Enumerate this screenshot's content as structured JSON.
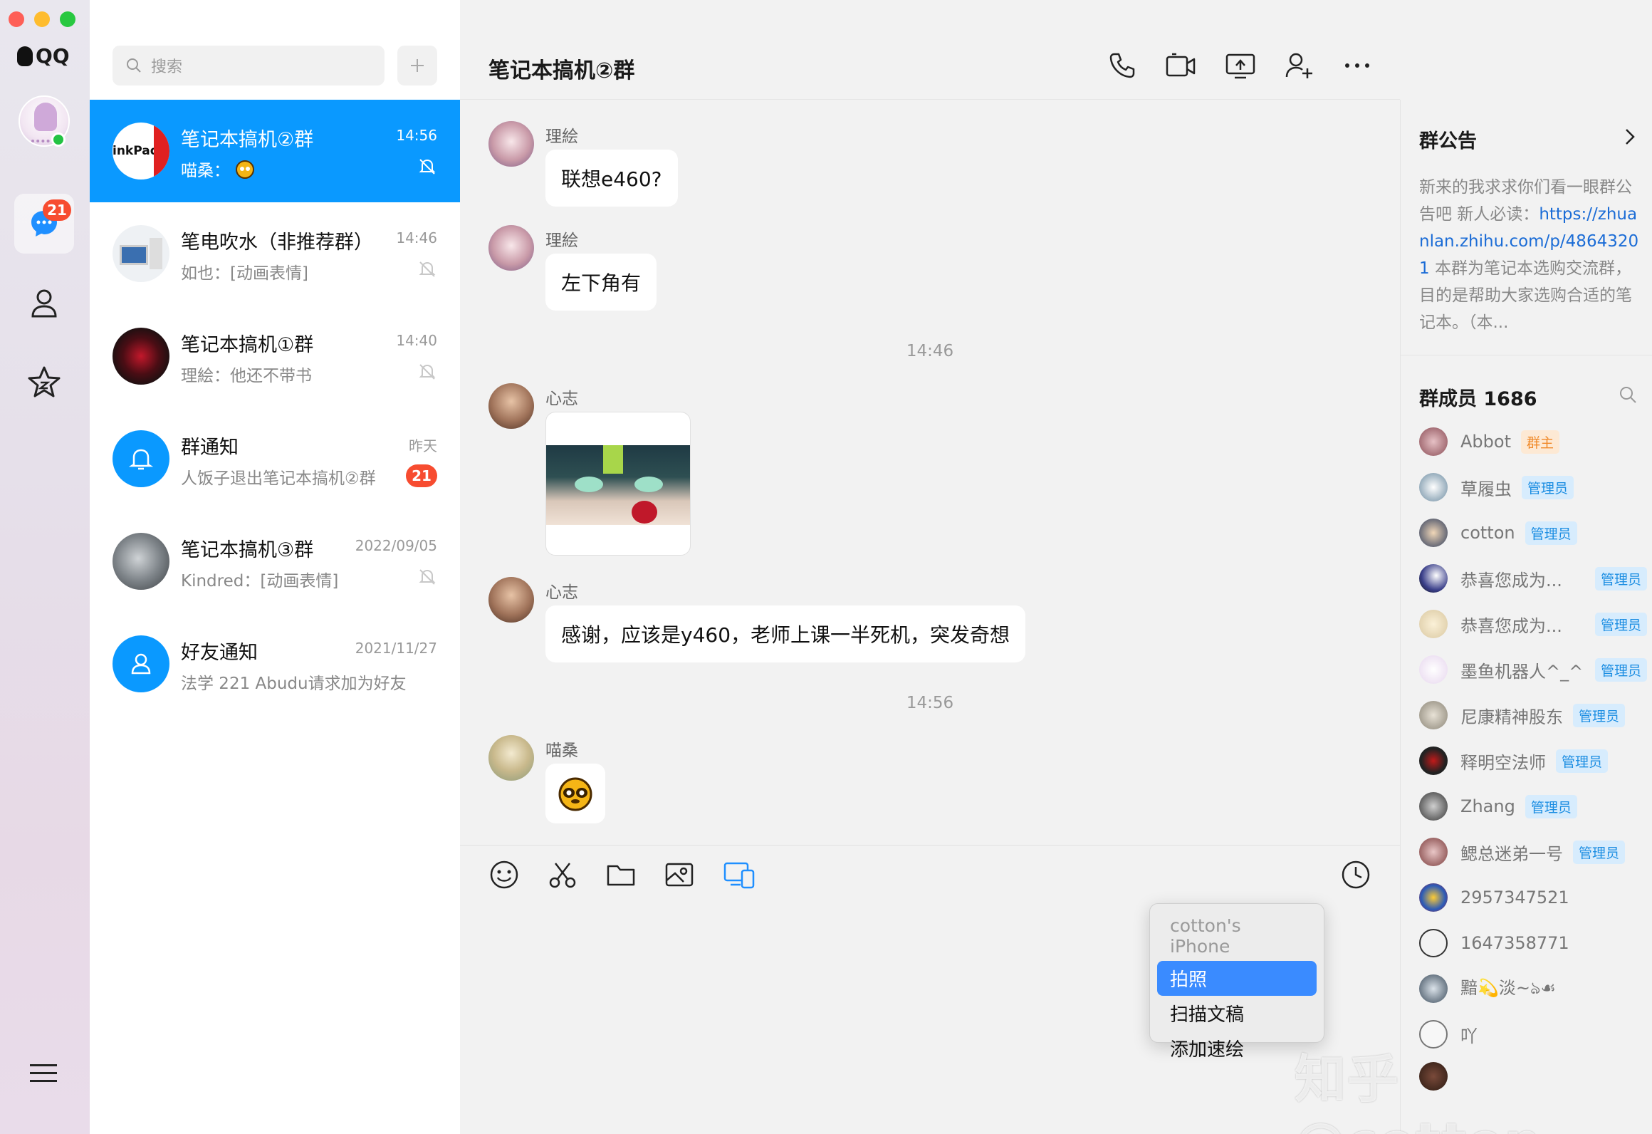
{
  "nav": {
    "app_name": "QQ",
    "messages_badge": "21",
    "items": [
      "chat-icon",
      "contacts-icon",
      "favorites-icon",
      "menu-icon"
    ]
  },
  "convlist": {
    "search_placeholder": "搜索",
    "items": [
      {
        "name": "笔记本搞机②群",
        "preview": "喵桑：",
        "time": "14:56",
        "muted": true,
        "active": true
      },
      {
        "name": "笔电吹水（非推荐群）",
        "preview": "如也：[动画表情]",
        "time": "14:46",
        "muted": true
      },
      {
        "name": "笔记本搞机①群",
        "preview": "理絵：他还不带书",
        "time": "14:40",
        "muted": true
      },
      {
        "name": "群通知",
        "preview": "人饭子退出笔记本搞机②群",
        "time": "昨天",
        "badge": "21"
      },
      {
        "name": "笔记本搞机③群",
        "preview": "Kindred：[动画表情]",
        "time": "2022/09/05",
        "muted": true
      },
      {
        "name": "好友通知",
        "preview": "法学 221 Abudu请求加为好友",
        "time": "2021/11/27"
      }
    ]
  },
  "chat": {
    "title": "笔记本搞机②群",
    "messages": [
      {
        "sender": "理絵",
        "text": "联想e460?"
      },
      {
        "sender": "理絵",
        "text": "左下角有"
      },
      {
        "timestamp": "14:46"
      },
      {
        "sender": "心志",
        "type": "image"
      },
      {
        "sender": "心志",
        "text": "感谢，应该是y460，老师上课一半死机，突发奇想"
      },
      {
        "timestamp": "14:56"
      },
      {
        "sender": "喵桑",
        "type": "sticker"
      }
    ],
    "timestamps": [
      "14:46",
      "14:56"
    ],
    "popup": {
      "device": "cotton's iPhone",
      "items": [
        "拍照",
        "扫描文稿",
        "添加速绘"
      ],
      "selected": "拍照"
    }
  },
  "right": {
    "notice_title": "群公告",
    "notice_text_1": "新来的我求求你们看一眼群公告吧 新人必读：",
    "notice_link": "https://zhuanlan.zhihu.com/p/48643201",
    "notice_text_2": " 本群为笔记本选购交流群，目的是帮助大家选购合适的笔记本。（本...",
    "members_title": "群成员 1686",
    "members": [
      {
        "name": "Abbot",
        "tag": "群主",
        "role": "owner"
      },
      {
        "name": "草履虫",
        "tag": "管理员",
        "role": "admin"
      },
      {
        "name": "cotton",
        "tag": "管理员",
        "role": "admin"
      },
      {
        "name": "恭喜您成为...",
        "tag": "管理员",
        "role": "admin"
      },
      {
        "name": "恭喜您成为...",
        "tag": "管理员",
        "role": "admin"
      },
      {
        "name": "墨鱼机器人^_^",
        "tag": "管理员",
        "role": "admin"
      },
      {
        "name": "尼康精神股东",
        "tag": "管理员",
        "role": "admin"
      },
      {
        "name": "释明空法师",
        "tag": "管理员",
        "role": "admin"
      },
      {
        "name": "Zhang",
        "tag": "管理员",
        "role": "admin"
      },
      {
        "name": "鳃总迷弟一号",
        "tag": "管理员",
        "role": "admin"
      },
      {
        "name": "2957347521",
        "tag": "",
        "role": ""
      },
      {
        "name": "1647358771",
        "tag": "",
        "role": ""
      },
      {
        "name": "黯💫淡~ঌ☙",
        "tag": "",
        "role": ""
      },
      {
        "name": "吖",
        "tag": "",
        "role": ""
      }
    ]
  },
  "watermark": "知乎 @cotton",
  "colors": {
    "accent": "#0a99ff",
    "badge": "#f74c30",
    "link": "#1b6cd6"
  }
}
